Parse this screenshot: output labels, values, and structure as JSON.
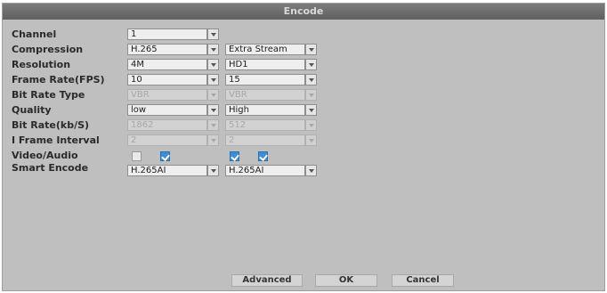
{
  "window": {
    "title": "Encode"
  },
  "labels": [
    "Channel",
    "Compression",
    "Resolution",
    "Frame Rate(FPS)",
    "Bit Rate Type",
    "Quality",
    "Bit Rate(kb/S)",
    "I Frame Interval",
    "Video/Audio",
    "Smart Encode"
  ],
  "main": {
    "channel": "1",
    "compression": "H.265",
    "resolution": "4M",
    "frame_rate": "10",
    "bit_rate_type": "VBR",
    "quality": "low",
    "bit_rate": "1862",
    "i_frame_interval": "2",
    "smart_encode": "H.265AI"
  },
  "extra": {
    "stream": "Extra Stream",
    "resolution": "HD1",
    "frame_rate": "15",
    "bit_rate_type": "VBR",
    "quality": "High",
    "bit_rate": "512",
    "i_frame_interval": "2",
    "smart_encode": "H.265AI"
  },
  "checkboxes": {
    "main_video": false,
    "main_audio": true,
    "extra_video": true,
    "extra_audio": true
  },
  "buttons": {
    "advanced": "Advanced",
    "ok": "OK",
    "cancel": "Cancel"
  },
  "colors": {
    "background": "#bfbfbf",
    "titlebar": "#5f5f5f",
    "checkbox_on": "#3a8fd6"
  }
}
